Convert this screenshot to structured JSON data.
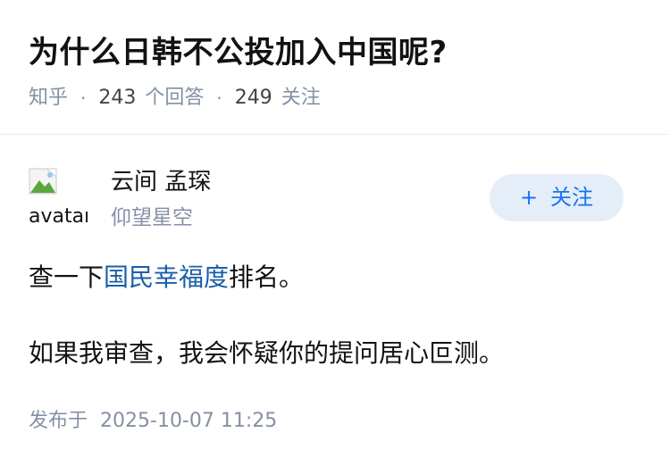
{
  "question": {
    "title": "为什么日韩不公投加入中国呢?",
    "source": "知乎",
    "answer_count": "243",
    "answer_label": "个回答",
    "follower_count": "249",
    "follower_label": "关注"
  },
  "author": {
    "avatar_alt": "avatar",
    "name": "云间 孟琛",
    "headline": "仰望星空",
    "follow_plus": "+",
    "follow_label": "关注"
  },
  "answer": {
    "line1_prefix": "查一下",
    "line1_link": "国民幸福度",
    "line1_suffix": "排名。",
    "line2": "如果我审查，我会怀疑你的提问居心叵测。"
  },
  "publish": {
    "label": "发布于",
    "datetime": "2025-10-07 11:25"
  },
  "colors": {
    "link": "#1a5fa8",
    "follow_bg": "#e5eef8",
    "follow_text": "#1772f6",
    "meta_gray": "#8590a6"
  }
}
